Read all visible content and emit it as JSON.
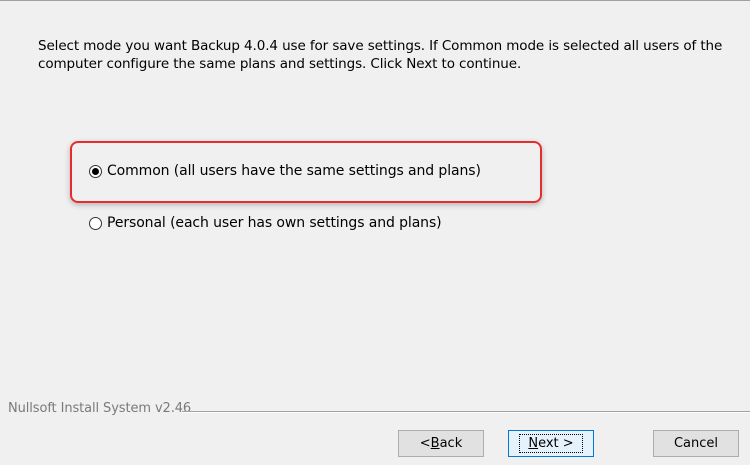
{
  "instructions": "Select mode you want Backup 4.0.4 use for save settings. If Common mode is selected all users of the computer configure the same plans and settings. Click Next to continue.",
  "options": [
    {
      "label": "Common (all users have the same settings and plans)",
      "selected": true
    },
    {
      "label": "Personal (each user has own settings and plans)",
      "selected": false
    }
  ],
  "branding": "Nullsoft Install System v2.46",
  "buttons": {
    "back_prefix": "< ",
    "back_mnemonic": "B",
    "back_rest": "ack",
    "next_mnemonic": "N",
    "next_rest": "ext >",
    "cancel": "Cancel"
  },
  "colors": {
    "highlight": "#e52d2d",
    "focus_border": "#0078d7"
  }
}
